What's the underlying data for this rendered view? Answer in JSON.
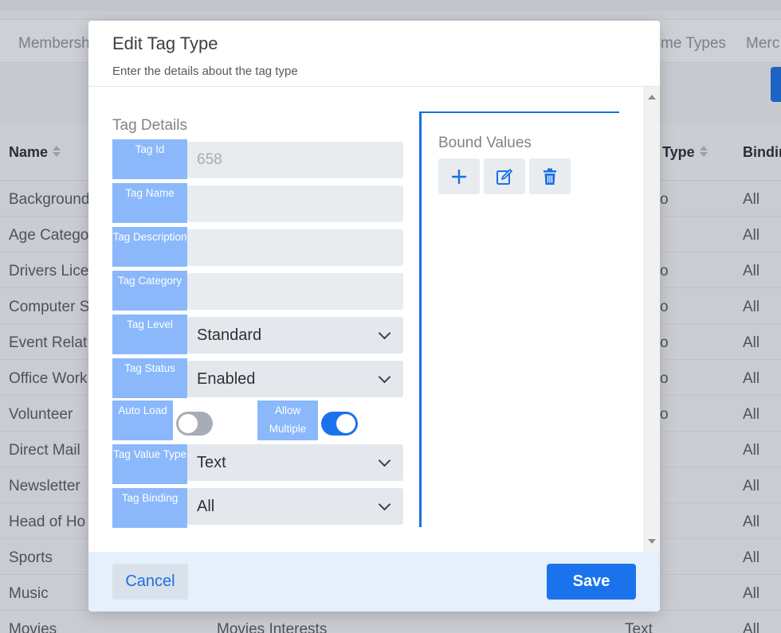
{
  "background": {
    "tabs": [
      "Membersh",
      "me Types",
      "Merc"
    ],
    "headers": {
      "name": "Name",
      "type": "Type",
      "binding": "Bindin"
    },
    "rows": [
      {
        "name": "Background",
        "type": "o",
        "binding": "All"
      },
      {
        "name": "Age Catego",
        "type": "",
        "binding": "All"
      },
      {
        "name": "Drivers Lice",
        "type": "o",
        "binding": "All"
      },
      {
        "name": "Computer S",
        "type": "o",
        "binding": "All"
      },
      {
        "name": "Event Relat",
        "type": "o",
        "binding": "All"
      },
      {
        "name": "Office Work",
        "type": "o",
        "binding": "All"
      },
      {
        "name": "Volunteer",
        "type": "o",
        "binding": "All"
      },
      {
        "name": "Direct Mail",
        "type": "",
        "binding": "All"
      },
      {
        "name": "Newsletter",
        "type": "",
        "binding": "All"
      },
      {
        "name": "Head of Ho",
        "type": "",
        "binding": "All"
      },
      {
        "name": "Sports",
        "type": "",
        "binding": "All"
      },
      {
        "name": "Music",
        "type": "",
        "binding": "All"
      },
      {
        "name": "Movies",
        "description": "Movies Interests",
        "type": "Text",
        "binding": "All"
      }
    ]
  },
  "modal": {
    "title": "Edit Tag Type",
    "subtitle": "Enter the details about the tag type",
    "section_title": "Tag Details",
    "fields": {
      "tag_id": {
        "label": "Tag Id",
        "value": "658"
      },
      "tag_name": {
        "label": "Tag Name",
        "value": ""
      },
      "tag_description": {
        "label": "Tag Description",
        "value": ""
      },
      "tag_category": {
        "label": "Tag Category",
        "value": ""
      },
      "tag_level": {
        "label": "Tag Level",
        "value": "Standard"
      },
      "tag_status": {
        "label": "Tag Status",
        "value": "Enabled"
      },
      "auto_load": {
        "label": "Auto Load",
        "checked": false
      },
      "allow_multiple": {
        "label": "Allow Multiple",
        "checked": true
      },
      "tag_value_type": {
        "label": "Tag Value Type",
        "value": "Text"
      },
      "tag_binding": {
        "label": "Tag Binding",
        "value": "All"
      }
    },
    "bound_values": {
      "title": "Bound Values",
      "buttons": [
        "plus-icon",
        "edit-icon",
        "trash-icon"
      ]
    },
    "footer": {
      "cancel": "Cancel",
      "save": "Save"
    }
  },
  "colors": {
    "accent": "#1a73ec",
    "label_bg": "#8ab8fb",
    "footer_bg": "#e6f0fc"
  }
}
